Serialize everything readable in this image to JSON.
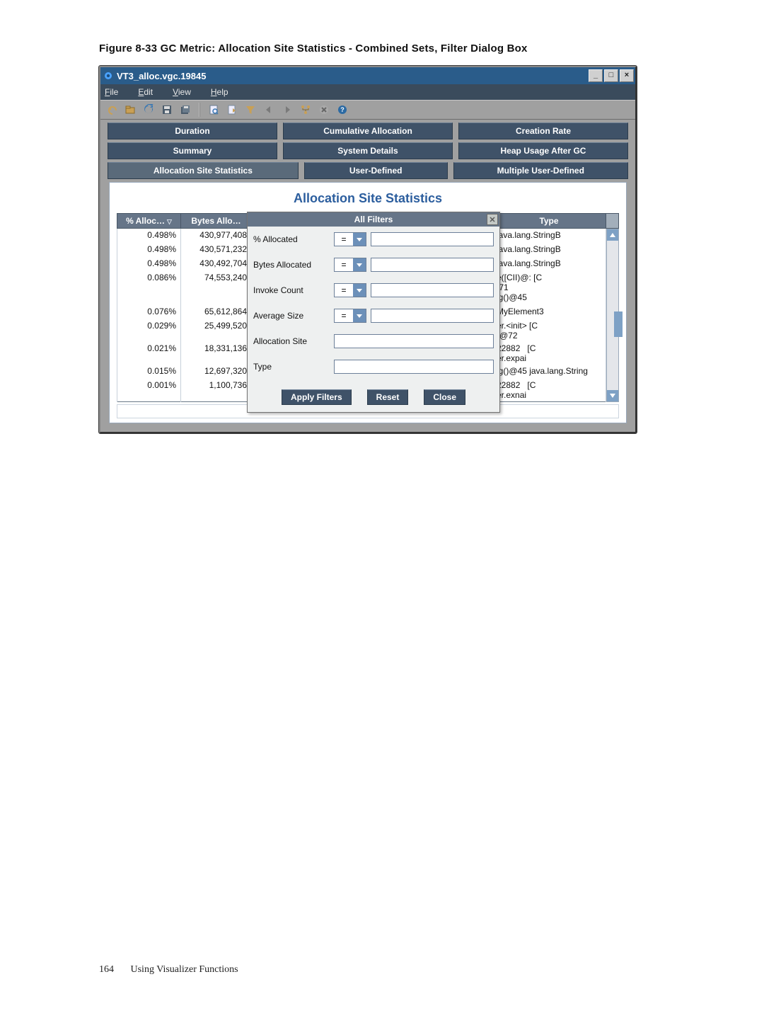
{
  "figure_caption": "Figure 8-33 GC Metric: Allocation Site Statistics - Combined Sets, Filter Dialog Box",
  "window": {
    "title": "VT3_alloc.vgc.19845",
    "menu": {
      "file": "File",
      "edit": "Edit",
      "view": "View",
      "help": "Help"
    }
  },
  "tabs": {
    "row1": [
      "Duration",
      "Cumulative Allocation",
      "Creation Rate"
    ],
    "row2": [
      "Summary",
      "System Details",
      "Heap Usage After GC"
    ],
    "row3": [
      "Allocation Site Statistics",
      "User-Defined",
      "Multiple User-Defined"
    ]
  },
  "content_title": "Allocation Site Statistics",
  "columns": {
    "pct_alloc": "% Alloc…",
    "bytes_alloc": "Bytes Allo…",
    "type": "Type"
  },
  "rows": [
    {
      "pct": "0.498%",
      "bytes": "430,977,408",
      "type": "java.lang.StringB"
    },
    {
      "pct": "0.498%",
      "bytes": "430,571,232",
      "type": "java.lang.StringB"
    },
    {
      "pct": "0.498%",
      "bytes": "430,492,704",
      "type": "java.lang.StringB"
    },
    {
      "pct": "0.086%",
      "bytes": "74,553,240",
      "type": "e([CII)@: [C\n:71\nig()@45"
    },
    {
      "pct": "0.076%",
      "bytes": "65,612,864",
      "type": "MyElement3"
    },
    {
      "pct": "0.029%",
      "bytes": "25,499,520",
      "type": "er.<init> [C\n)@72"
    },
    {
      "pct": "0.021%",
      "bytes": "18,331,136",
      "type": "22882   [C\ner.expai"
    },
    {
      "pct": "0.015%",
      "bytes": "12,697,320",
      "type": "ig()@45 java.lang.String"
    },
    {
      "pct": "0.001%",
      "bytes": "1,100,736",
      "type": "22882   [C\ner.exnai"
    }
  ],
  "filter_dialog": {
    "title": "All Filters",
    "fields": {
      "pct_allocated": "% Allocated",
      "bytes_allocated": "Bytes Allocated",
      "invoke_count": "Invoke Count",
      "average_size": "Average Size",
      "allocation_site": "Allocation Site",
      "type": "Type"
    },
    "operator": "=",
    "buttons": {
      "apply": "Apply Filters",
      "reset": "Reset",
      "close": "Close"
    }
  },
  "footer": {
    "page": "164",
    "section": "Using Visualizer Functions"
  }
}
